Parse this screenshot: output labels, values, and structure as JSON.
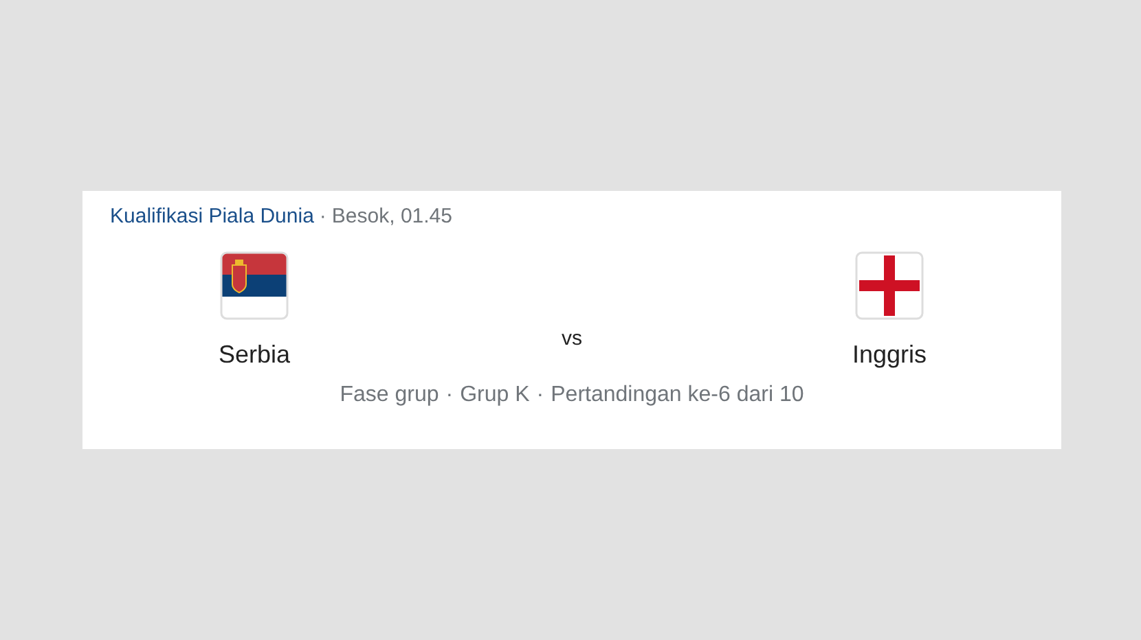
{
  "header": {
    "competition": "Kualifikasi Piala Dunia",
    "separator": "·",
    "time": "Besok, 01.45"
  },
  "teams": [
    {
      "name": "Serbia",
      "kind": "tricolor"
    },
    {
      "name": "Inggris",
      "kind": "cross"
    }
  ],
  "versus": "vs",
  "footer": [
    {
      "text": "Fase grup"
    },
    {
      "text": "Grup K"
    },
    {
      "text": "Pertandingan ke-6 dari 10"
    }
  ],
  "footer_separator": "·"
}
